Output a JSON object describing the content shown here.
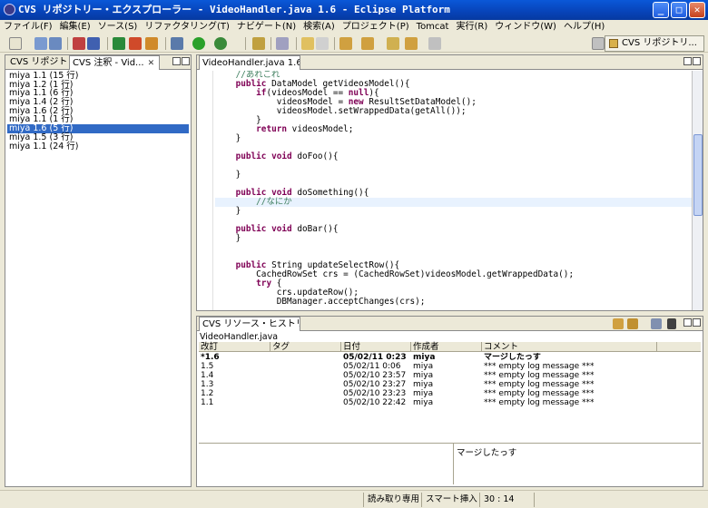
{
  "window": {
    "title": "CVS リポジトリー・エクスプローラー - VideoHandler.java 1.6 - Eclipse Platform",
    "min_label": "_",
    "max_label": "□",
    "close_label": "✕"
  },
  "menu": [
    "ファイル(F)",
    "編集(E)",
    "ソース(S)",
    "リファクタリング(T)",
    "ナビゲート(N)",
    "検索(A)",
    "プロジェクト(P)",
    "Tomcat",
    "実行(R)",
    "ウィンドウ(W)",
    "ヘルプ(H)"
  ],
  "perspective": {
    "label": "CVS リポジトリ..."
  },
  "left_panel": {
    "tabs": [
      "CVS リポジトリー",
      "CVS 注釈 - Vid..."
    ],
    "close_glyph": "✕",
    "items": [
      {
        "label": "miya 1.1 (15 行)",
        "selected": false
      },
      {
        "label": "miya 1.2 (1 行)",
        "selected": false
      },
      {
        "label": "miya 1.1 (6 行)",
        "selected": false
      },
      {
        "label": "miya 1.4 (2 行)",
        "selected": false
      },
      {
        "label": "miya 1.6 (2 行)",
        "selected": false
      },
      {
        "label": "miya 1.1 (1 行)",
        "selected": false
      },
      {
        "label": "miya 1.6 (5 行)",
        "selected": true
      },
      {
        "label": "miya 1.5 (3 行)",
        "selected": false
      },
      {
        "label": "miya 1.1 (24 行)",
        "selected": false
      }
    ]
  },
  "editor": {
    "tab_label": "VideoHandler.java 1.6",
    "close_glyph": "✕",
    "highlight_line": 14,
    "lines": [
      [
        [
          "    ",
          "n"
        ],
        [
          "//あれこれ",
          "c"
        ]
      ],
      [
        [
          "    ",
          "n"
        ],
        [
          "public",
          "k"
        ],
        [
          " DataModel getVideosModel(){",
          "n"
        ]
      ],
      [
        [
          "        ",
          "n"
        ],
        [
          "if",
          "k"
        ],
        [
          "(videosModel == ",
          "n"
        ],
        [
          "null",
          "k"
        ],
        [
          "){",
          "n"
        ]
      ],
      [
        [
          "            videosModel = ",
          "n"
        ],
        [
          "new",
          "k"
        ],
        [
          " ResultSetDataModel();",
          "n"
        ]
      ],
      [
        [
          "            videosModel.setWrappedData(getAll());",
          "n"
        ]
      ],
      [
        [
          "        }",
          "n"
        ]
      ],
      [
        [
          "        ",
          "n"
        ],
        [
          "return",
          "k"
        ],
        [
          " videosModel;",
          "n"
        ]
      ],
      [
        [
          "    }",
          "n"
        ]
      ],
      [
        [
          "",
          "n"
        ]
      ],
      [
        [
          "    ",
          "n"
        ],
        [
          "public",
          "k"
        ],
        [
          " ",
          "n"
        ],
        [
          "void",
          "k"
        ],
        [
          " doFoo(){",
          "n"
        ]
      ],
      [
        [
          "",
          "n"
        ]
      ],
      [
        [
          "    }",
          "n"
        ]
      ],
      [
        [
          "",
          "n"
        ]
      ],
      [
        [
          "    ",
          "n"
        ],
        [
          "public",
          "k"
        ],
        [
          " ",
          "n"
        ],
        [
          "void",
          "k"
        ],
        [
          " doSomething(){",
          "n"
        ]
      ],
      [
        [
          "        ",
          "n"
        ],
        [
          "//なにか",
          "c"
        ]
      ],
      [
        [
          "    }",
          "n"
        ]
      ],
      [
        [
          "",
          "n"
        ]
      ],
      [
        [
          "    ",
          "n"
        ],
        [
          "public",
          "k"
        ],
        [
          " ",
          "n"
        ],
        [
          "void",
          "k"
        ],
        [
          " doBar(){",
          "n"
        ]
      ],
      [
        [
          "    }",
          "n"
        ]
      ],
      [
        [
          "",
          "n"
        ]
      ],
      [
        [
          "",
          "n"
        ]
      ],
      [
        [
          "    ",
          "n"
        ],
        [
          "public",
          "k"
        ],
        [
          " String updateSelectRow(){",
          "n"
        ]
      ],
      [
        [
          "        CachedRowSet crs = (CachedRowSet)videosModel.getWrappedData();",
          "n"
        ]
      ],
      [
        [
          "        ",
          "n"
        ],
        [
          "try",
          "k"
        ],
        [
          " {",
          "n"
        ]
      ],
      [
        [
          "            crs.updateRow();",
          "n"
        ]
      ],
      [
        [
          "            DBManager.acceptChanges(crs);",
          "n"
        ]
      ]
    ],
    "scroll_fraction": 0.4
  },
  "history": {
    "tab_label": "CVS リソース・ヒストリー",
    "close_glyph": "✕",
    "path": "VideoHandler.java",
    "columns": [
      "改訂",
      "タグ",
      "日付",
      "作成者",
      "コメント"
    ],
    "rows": [
      {
        "rev": "*1.6",
        "tag": "",
        "date": "05/02/11 0:23",
        "author": "miya",
        "comment": "マージしたっす",
        "bold": true
      },
      {
        "rev": "1.5",
        "tag": "",
        "date": "05/02/11 0:06",
        "author": "miya",
        "comment": "*** empty log message ***",
        "bold": false
      },
      {
        "rev": "1.4",
        "tag": "",
        "date": "05/02/10 23:57",
        "author": "miya",
        "comment": "*** empty log message ***",
        "bold": false
      },
      {
        "rev": "1.3",
        "tag": "",
        "date": "05/02/10 23:27",
        "author": "miya",
        "comment": "*** empty log message ***",
        "bold": false
      },
      {
        "rev": "1.2",
        "tag": "",
        "date": "05/02/10 23:23",
        "author": "miya",
        "comment": "*** empty log message ***",
        "bold": false
      },
      {
        "rev": "1.1",
        "tag": "",
        "date": "05/02/10 22:42",
        "author": "miya",
        "comment": "*** empty log message ***",
        "bold": false
      }
    ],
    "comment_text": "マージしたっす"
  },
  "status": {
    "readonly": "読み取り専用",
    "insert_mode": "スマート挿入",
    "position": "30 : 14"
  },
  "colors": {
    "titlebar": "#0743b8",
    "selection": "#316ac5",
    "keyword": "#7f0055",
    "comment": "#3f7f5f"
  }
}
